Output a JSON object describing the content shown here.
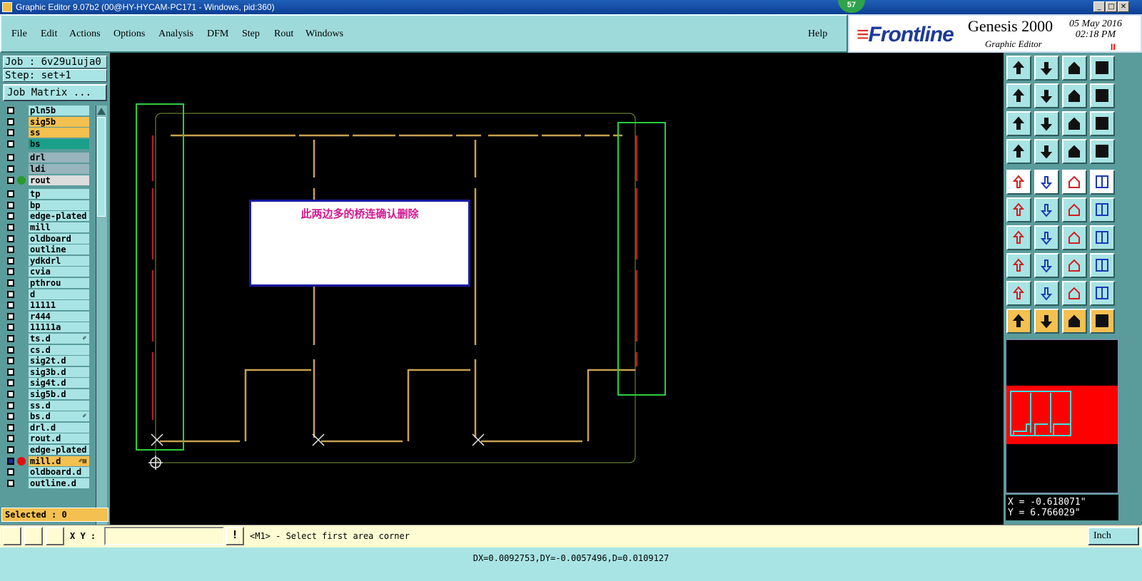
{
  "window": {
    "title": "Graphic Editor 9.07b2 (00@HY-HYCAM-PC171 - Windows, pid:360)",
    "min": "_",
    "max": "□",
    "close": "✕",
    "badge": "57"
  },
  "menu": {
    "items": [
      "File",
      "Edit",
      "Actions",
      "Options",
      "Analysis",
      "DFM",
      "Step",
      "Rout",
      "Windows"
    ],
    "help": "Help"
  },
  "brand": {
    "logo": "Frontline",
    "product": "Genesis 2000",
    "subtitle": "Graphic Editor",
    "date": "05 May 2016",
    "time": "02:18 PM",
    "pause": "II"
  },
  "job": {
    "label": "Job : 6v29u1uja0",
    "step": "Step: set+1",
    "matrix_button": "Job Matrix ..."
  },
  "layers": [
    {
      "name": "pln5b",
      "bg": "#a9e4e4"
    },
    {
      "name": "sig5b",
      "bg": "#f4c050"
    },
    {
      "name": "ss",
      "bg": "#f4c050"
    },
    {
      "name": "bs",
      "bg": "#1aa08a"
    },
    {
      "name": "drl",
      "bg": "#98b4bc"
    },
    {
      "name": "ldi",
      "bg": "#98b4bc"
    },
    {
      "name": "rout",
      "bg": "#dcdcdc",
      "indicator": "#2a9a2a"
    },
    {
      "name": "tp",
      "bg": "#a9e4e4"
    },
    {
      "name": "bp",
      "bg": "#a9e4e4"
    },
    {
      "name": "edge-plated",
      "bg": "#a9e4e4"
    },
    {
      "name": "mill",
      "bg": "#a9e4e4"
    },
    {
      "name": "oldboard",
      "bg": "#a9e4e4"
    },
    {
      "name": "outline",
      "bg": "#a9e4e4"
    },
    {
      "name": "ydkdrl",
      "bg": "#a9e4e4"
    },
    {
      "name": "cvia",
      "bg": "#a9e4e4"
    },
    {
      "name": "pthrou",
      "bg": "#a9e4e4"
    },
    {
      "name": "d",
      "bg": "#a9e4e4"
    },
    {
      "name": "11111",
      "bg": "#a9e4e4"
    },
    {
      "name": "r444",
      "bg": "#a9e4e4"
    },
    {
      "name": "11111a",
      "bg": "#a9e4e4"
    },
    {
      "name": "ts.d",
      "bg": "#a9e4e4",
      "mark": "✐"
    },
    {
      "name": "cs.d",
      "bg": "#a9e4e4"
    },
    {
      "name": "sig2t.d",
      "bg": "#a9e4e4"
    },
    {
      "name": "sig3b.d",
      "bg": "#a9e4e4"
    },
    {
      "name": "sig4t.d",
      "bg": "#a9e4e4"
    },
    {
      "name": "sig5b.d",
      "bg": "#a9e4e4"
    },
    {
      "name": "ss.d",
      "bg": "#a9e4e4"
    },
    {
      "name": "bs.d",
      "bg": "#a9e4e4",
      "mark": "✐"
    },
    {
      "name": "drl.d",
      "bg": "#a9e4e4"
    },
    {
      "name": "rout.d",
      "bg": "#a9e4e4"
    },
    {
      "name": "edge-plated",
      "bg": "#a9e4e4"
    },
    {
      "name": "mill.d",
      "bg": "#f4c050",
      "indicator": "#e01010",
      "checked": true,
      "mark": "✐▤"
    },
    {
      "name": "oldboard.d",
      "bg": "#a9e4e4"
    },
    {
      "name": "outline.d",
      "bg": "#a9e4e4"
    }
  ],
  "selected": "Selected : 0",
  "annotation": {
    "text": "此两边多的桥连确认删除"
  },
  "coords": {
    "x": "X = -0.618071\"",
    "y": "Y =  6.766029\""
  },
  "bottom": {
    "xy_label": "X Y :",
    "xy_value": "",
    "prompt": "<M1> - Select first area corner",
    "unit": "Inch"
  },
  "status": {
    "text": "DX=0.0092753,DY=-0.0057496,D=0.0109127"
  },
  "colors": {
    "panel": "#a9e4e4",
    "accent_yellow": "#f4c050",
    "rout_line": "#c8a050",
    "highlight_line": "#b02020",
    "selection_box": "#2ecc40",
    "outline": "#7a9a3a"
  }
}
